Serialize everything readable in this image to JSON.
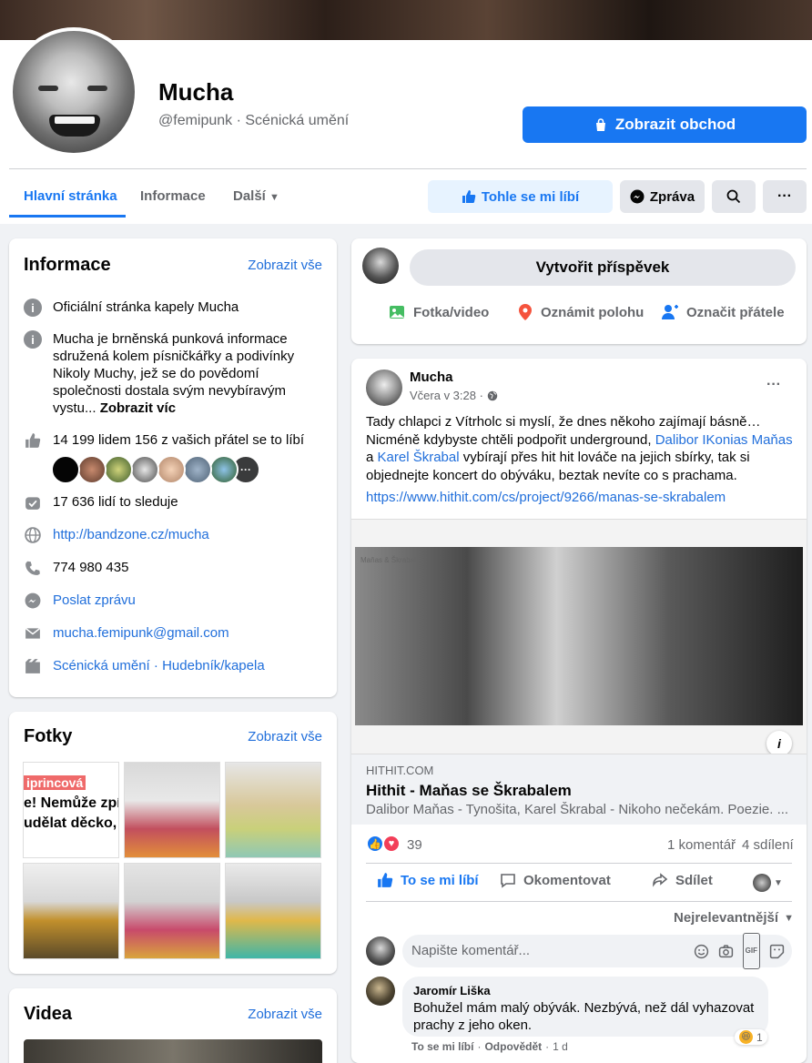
{
  "page": {
    "name": "Mucha",
    "subtitle": "@femipunk · Scénická umění",
    "shop_button": "Zobrazit obchod"
  },
  "tabs": [
    "Hlavní stránka",
    "Informace",
    "Další"
  ],
  "actions": {
    "like": "Tohle se mi líbí",
    "message": "Zpráva",
    "more": "···"
  },
  "about": {
    "title": "Informace",
    "see_all": "Zobrazit vše",
    "official": "Oficiální stránka kapely Mucha",
    "description": "Mucha je brněnská punková informace sdružená kolem písničkářky a podivínky Nikoly Muchy, jež se do povědomí společnosti dostala svým nevybíravým vystu...",
    "see_more": "Zobrazit víc",
    "likes": "14 199 lidem 156 z vašich přátel se to líbí",
    "followers": "17 636 lidí to sleduje",
    "website": "http://bandzone.cz/mucha",
    "phone": "774 980 435",
    "send_message": "Poslat zprávu",
    "email": "mucha.femipunk@gmail.com",
    "category_1": "Scénická umění",
    "category_sep": " · ",
    "category_2": "Hudebník/kapela"
  },
  "photos": {
    "title": "Fotky",
    "see_all": "Zobrazit vše",
    "thumb_text_1": "iprincová",
    "thumb_text_2": "e! Nemůže zpív",
    "thumb_text_3": "udělat děcko, a"
  },
  "videos": {
    "title": "Videa",
    "see_all": "Zobrazit vše"
  },
  "composer": {
    "placeholder": "Vytvořit příspěvek",
    "photo_video": "Fotka/video",
    "check_in": "Oznámit polohu",
    "tag_friends": "Označit přátele"
  },
  "post": {
    "author": "Mucha",
    "time": "Včera v 3:28 ·",
    "text_1": "Tady chlapci z Vítrholc si myslí, že dnes někoho zajímají básně…",
    "text_2": "Nicméně kdybyste chtěli podpořit underground, ",
    "mention_1": "Dalibor IKonias Maňas",
    "text_3": " a ",
    "mention_2": "Karel Škrabal",
    "text_4": " vybírají přes hit hit lováče na jejich sbírky, tak si objednejte koncert do obýváku, beztak nevíte co s prachama.",
    "url": "https://www.hithit.com/cs/project/9266/manas-se-skrabalem",
    "preview_caption_left": "Maňas & Škrabal",
    "link_domain": "HITHIT.COM",
    "link_title": "Hithit - Maňas se Škrabalem",
    "link_desc": "Dalibor Maňas - Tynošita, Karel Škrabal - Nikoho nečekám. Poezie. ...",
    "info_icon": "i",
    "reactions_count": "39",
    "comments_count": "1 komentář",
    "shares_count": "4 sdílení",
    "like_action": "To se mi líbí",
    "comment_action": "Okomentovat",
    "share_action": "Sdílet",
    "sort": "Nejrelevantnější",
    "comment_placeholder": "Napište komentář...",
    "gif": "GIF"
  },
  "comment": {
    "author": "Jaromír Liška",
    "text": "Bohužel mám malý obývák. Nezbývá, než dál vyhazovat prachy z jeho oken.",
    "like": "To se mi líbí",
    "reply": "Odpovědět",
    "time": "1 d",
    "reaction_count": "1"
  },
  "colors": {
    "accent": "#1877f2",
    "link": "#216fdb",
    "secondary_text": "#65676b",
    "background": "#f0f2f5"
  }
}
